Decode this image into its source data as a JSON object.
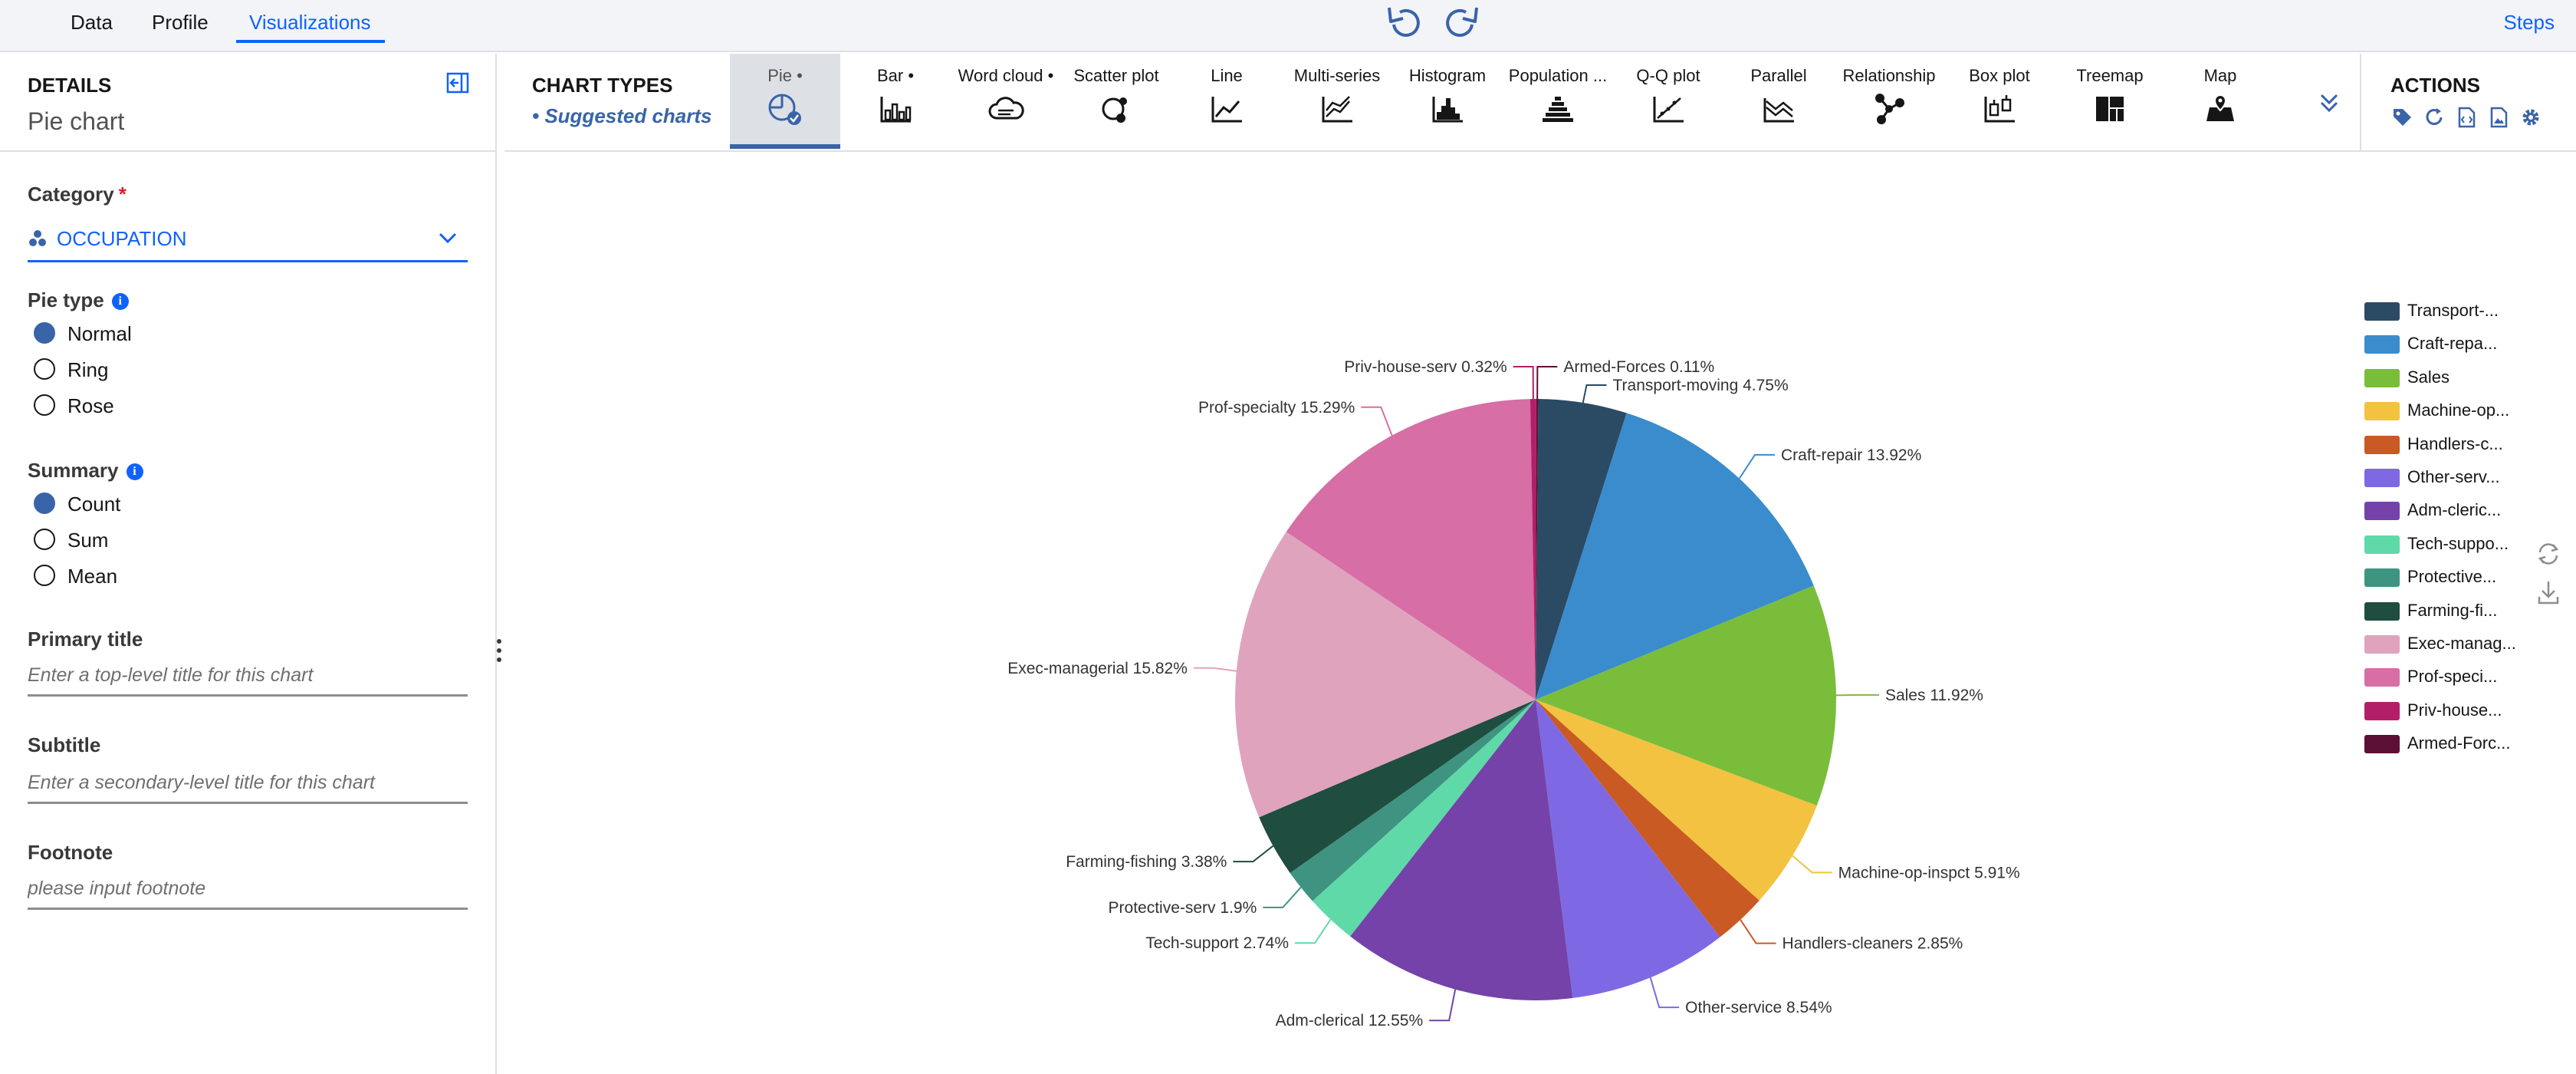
{
  "nav": {
    "tabs": [
      {
        "label": "Data"
      },
      {
        "label": "Profile"
      },
      {
        "label": "Visualizations"
      }
    ],
    "steps_label": "Steps"
  },
  "details": {
    "heading": "DETAILS",
    "chart_name": "Pie chart",
    "category": {
      "label": "Category",
      "required_mark": "*",
      "value": "OCCUPATION"
    },
    "pie_type": {
      "label": "Pie type",
      "options": [
        "Normal",
        "Ring",
        "Rose"
      ],
      "selected": "Normal"
    },
    "summary": {
      "label": "Summary",
      "options": [
        "Count",
        "Sum",
        "Mean"
      ],
      "selected": "Count"
    },
    "primary_title": {
      "label": "Primary title",
      "placeholder": "Enter a top-level title for this chart"
    },
    "subtitle": {
      "label": "Subtitle",
      "placeholder": "Enter a secondary-level title for this chart"
    },
    "footnote": {
      "label": "Footnote",
      "placeholder": "please input footnote"
    }
  },
  "chart_types": {
    "heading": "CHART TYPES",
    "suggested_label": "• Suggested charts",
    "items": [
      {
        "label": "Pie •",
        "icon": "pie-chart-icon",
        "active": true
      },
      {
        "label": "Bar •",
        "icon": "bar-chart-icon"
      },
      {
        "label": "Word cloud •",
        "icon": "word-cloud-icon"
      },
      {
        "label": "Scatter plot",
        "icon": "scatter-plot-icon"
      },
      {
        "label": "Line",
        "icon": "line-chart-icon"
      },
      {
        "label": "Multi-series",
        "icon": "multi-series-icon"
      },
      {
        "label": "Histogram",
        "icon": "histogram-icon"
      },
      {
        "label": "Population ...",
        "icon": "population-pyramid-icon"
      },
      {
        "label": "Q-Q plot",
        "icon": "qq-plot-icon"
      },
      {
        "label": "Parallel",
        "icon": "parallel-icon"
      },
      {
        "label": "Relationship",
        "icon": "relationship-icon"
      },
      {
        "label": "Box plot",
        "icon": "box-plot-icon"
      },
      {
        "label": "Treemap",
        "icon": "treemap-icon"
      },
      {
        "label": "Map",
        "icon": "map-icon"
      }
    ]
  },
  "actions": {
    "heading": "ACTIONS",
    "icons": [
      "tag-icon",
      "refresh-icon",
      "code-icon",
      "image-icon",
      "settings-icon"
    ]
  },
  "colors": {
    "accent": "#0f62fe",
    "selected": "#3a64a8"
  },
  "chart_data": {
    "type": "pie",
    "unit": "%",
    "slices": [
      {
        "name": "Transport-moving",
        "value": 4.75,
        "color": "#2b4a64",
        "legend": "Transport-..."
      },
      {
        "name": "Craft-repair",
        "value": 13.92,
        "color": "#3a8ccd",
        "legend": "Craft-repa..."
      },
      {
        "name": "Sales",
        "value": 11.92,
        "color": "#7abd3a",
        "legend": "Sales"
      },
      {
        "name": "Machine-op-inspct",
        "value": 5.91,
        "color": "#f2c240",
        "legend": "Machine-op..."
      },
      {
        "name": "Handlers-cleaners",
        "value": 2.85,
        "color": "#c95a24",
        "legend": "Handlers-c..."
      },
      {
        "name": "Other-service",
        "value": 8.54,
        "color": "#7f68e3",
        "legend": "Other-serv..."
      },
      {
        "name": "Adm-clerical",
        "value": 12.55,
        "color": "#7442a8",
        "legend": "Adm-cleric..."
      },
      {
        "name": "Tech-support",
        "value": 2.74,
        "color": "#5fd9a8",
        "legend": "Tech-suppo..."
      },
      {
        "name": "Protective-serv",
        "value": 1.9,
        "color": "#3e9480",
        "legend": "Protective..."
      },
      {
        "name": "Farming-fishing",
        "value": 3.38,
        "color": "#1f4d40",
        "legend": "Farming-fi..."
      },
      {
        "name": "Exec-managerial",
        "value": 15.82,
        "color": "#e0a3bd",
        "legend": "Exec-manag..."
      },
      {
        "name": "Prof-specialty",
        "value": 15.29,
        "color": "#d76ea6",
        "legend": "Prof-speci..."
      },
      {
        "name": "Priv-house-serv",
        "value": 0.32,
        "color": "#b21f68",
        "legend": "Priv-house..."
      },
      {
        "name": "Armed-Forces",
        "value": 0.11,
        "color": "#5c1036",
        "legend": "Armed-Forc..."
      }
    ]
  }
}
